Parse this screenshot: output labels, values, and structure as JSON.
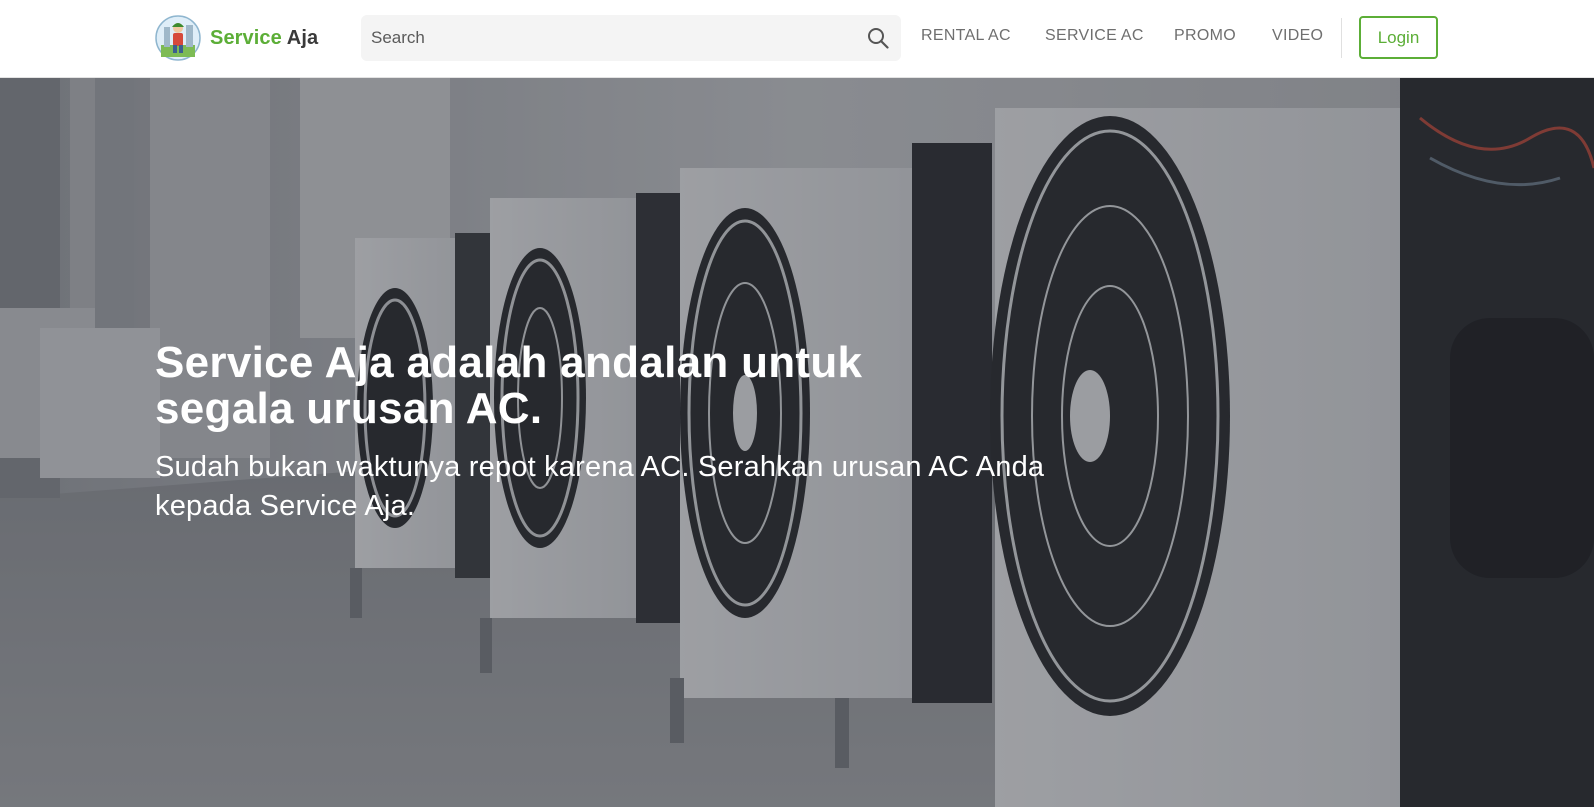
{
  "header": {
    "brand": {
      "word1": "Service",
      "word2": "Aja",
      "word1_color": "#5cae37",
      "word2_color": "#3a3a3a",
      "logo_icon": "mascot-logo-icon"
    },
    "search": {
      "placeholder": "Search",
      "value": "",
      "icon": "search-icon"
    },
    "nav": [
      {
        "label": "RENTAL AC"
      },
      {
        "label": "SERVICE AC"
      },
      {
        "label": "PROMO"
      },
      {
        "label": "VIDEO"
      }
    ],
    "login_label": "Login",
    "accent_color": "#5cae37"
  },
  "hero": {
    "title": "Service Aja adalah andalan untuk segala urusan AC.",
    "subtitle": "Sudah bukan waktunya repot karena AC. Serahkan urusan AC Anda kepada Service Aja.",
    "background": "air-conditioner-outdoor-units-photo"
  }
}
